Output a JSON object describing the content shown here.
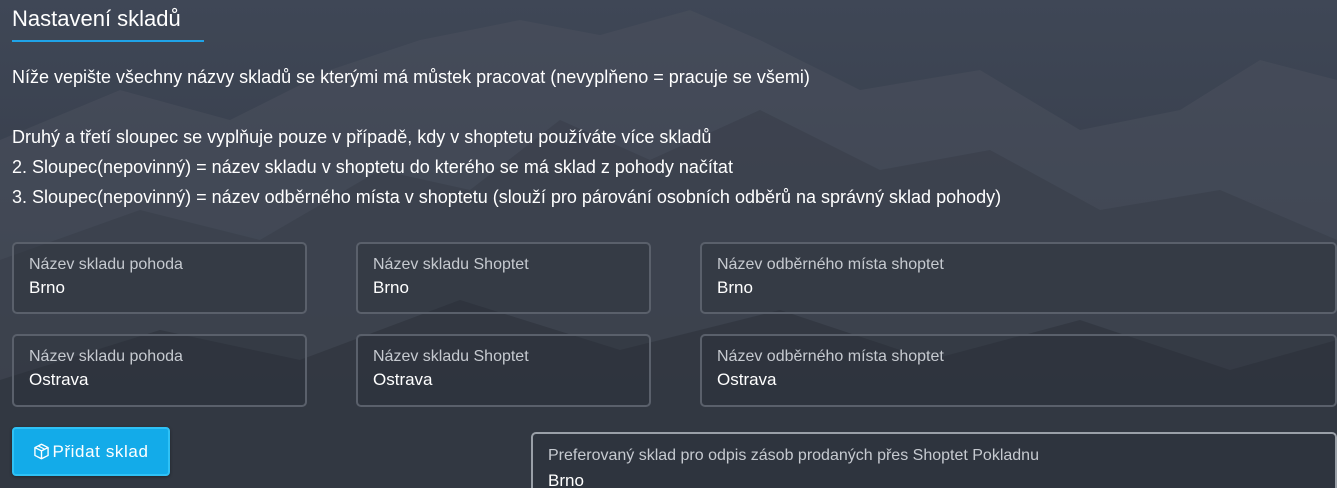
{
  "section": {
    "title": "Nastavení skladů"
  },
  "intro": {
    "line1": "Níže vepište všechny názvy skladů se kterými má můstek pracovat (nevyplňeno = pracuje se všemi)",
    "line2": "Druhý a třetí sloupec se vyplňuje pouze v případě, kdy v shoptetu používáte více skladů",
    "line3": "2. Sloupec(nepovinný) = název skladu v shoptetu do kterého se má sklad z pohody načítat",
    "line4": "3. Sloupec(nepovinný) = název odběrného místa v shoptetu (slouží pro párování osobních odběrů na správný sklad pohody)"
  },
  "rows": [
    {
      "pohoda_label": "Název skladu pohoda",
      "pohoda_value": "Brno",
      "shoptet_label": "Název skladu Shoptet",
      "shoptet_value": "Brno",
      "pickup_label": "Název odběrného místa shoptet",
      "pickup_value": "Brno"
    },
    {
      "pohoda_label": "Název skladu pohoda",
      "pohoda_value": "Ostrava",
      "shoptet_label": "Název skladu Shoptet",
      "shoptet_value": "Ostrava",
      "pickup_label": "Název odběrného místa shoptet",
      "pickup_value": "Ostrava"
    }
  ],
  "add_button": {
    "icon": "box-icon",
    "label": "Přidat sklad"
  },
  "preferred": {
    "label": "Preferovaný sklad pro odpis zásob prodaných přes Shoptet Pokladnu",
    "value": "Brno"
  },
  "colors": {
    "accent": "#13abe9",
    "field_border": "#5a606b",
    "background": "#39404d"
  }
}
